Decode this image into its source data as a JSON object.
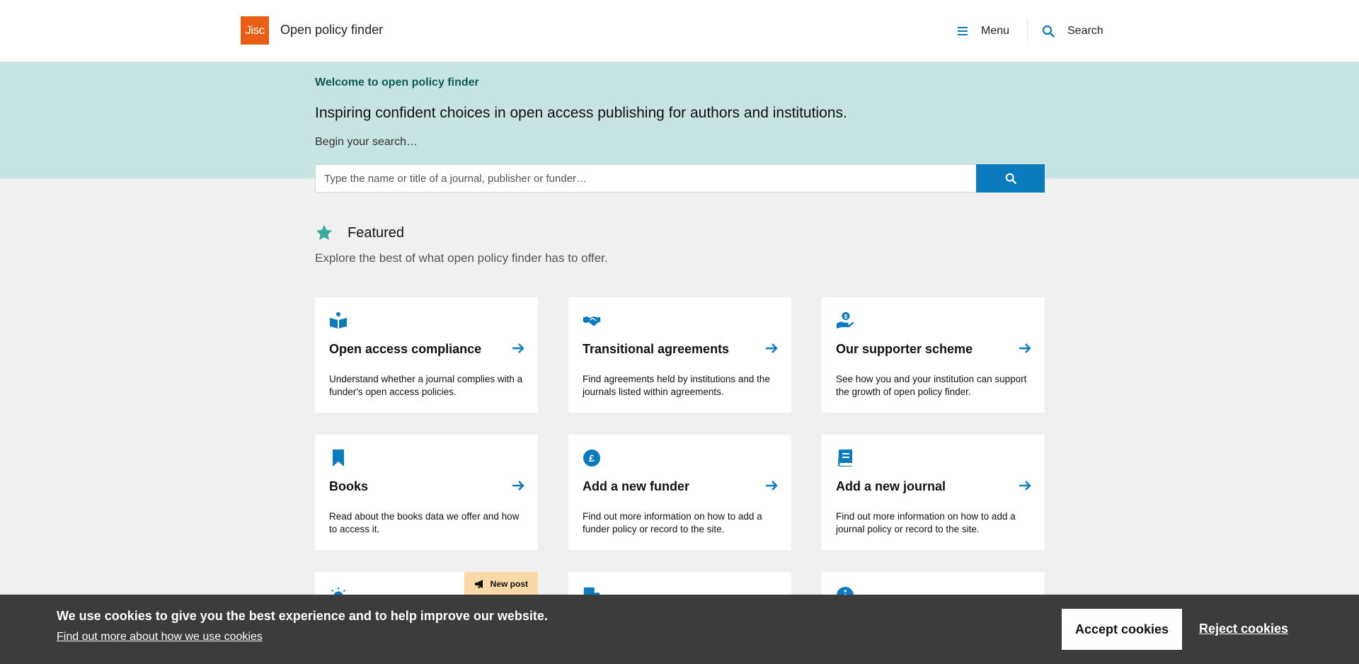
{
  "header": {
    "logo_text": "Jisc",
    "site_title": "Open policy finder",
    "menu_label": "Menu",
    "search_label": "Search"
  },
  "hero": {
    "welcome": "Welcome to open policy finder",
    "tagline": "Inspiring confident choices in open access publishing for authors and institutions.",
    "begin": "Begin your search…",
    "search_placeholder": "Type the name or title of a journal, publisher or funder…"
  },
  "featured": {
    "title": "Featured",
    "subtitle": "Explore the best of what open policy finder has to offer.",
    "cards": [
      {
        "title": "Open access compliance",
        "description": "Understand whether a journal complies with a funder's open access policies.",
        "icon": "open-book-icon"
      },
      {
        "title": "Transitional agreements",
        "description": "Find agreements held by institutions and the journals listed within agreements.",
        "icon": "handshake-icon"
      },
      {
        "title": "Our supporter scheme",
        "description": "See how you and your institution can support the growth of open policy finder.",
        "icon": "hand-coin-icon"
      },
      {
        "title": "Books",
        "description": "Read about the books data we offer and how to access it.",
        "icon": "bookmark-icon"
      },
      {
        "title": "Add a new funder",
        "description": "Find out more information on how to add a funder policy or record to the site.",
        "icon": "pound-coin-icon"
      },
      {
        "title": "Add a new journal",
        "description": "Find out more information on how to add a journal policy or record to the site.",
        "icon": "journal-icon"
      }
    ],
    "badge_label": "New post"
  },
  "cookie": {
    "message": "We use cookies to give you the best experience and to help improve our website.",
    "link": "Find out more about how we use cookies",
    "accept": "Accept cookies",
    "reject": "Reject cookies"
  },
  "colors": {
    "accent_blue": "#0a7cbd",
    "brand_orange": "#e85e13",
    "hero_bg": "#c6e4e1",
    "teal_star": "#3aa99f",
    "cookie_bg": "#3c3c3c"
  }
}
